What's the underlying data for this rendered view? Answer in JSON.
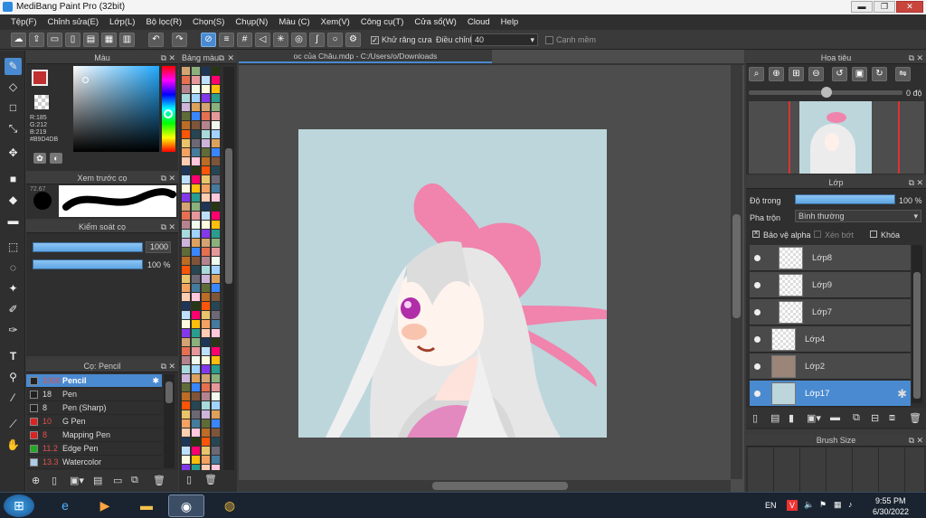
{
  "window": {
    "title": "MediBang Paint Pro (32bit)",
    "minimize": "▬",
    "restore": "❐",
    "close": "✕"
  },
  "menu": [
    "Tệp(F)",
    "Chỉnh sửa(E)",
    "Lớp(L)",
    "Bộ lọc(R)",
    "Chọn(S)",
    "Chụp(N)",
    "Màu (C)",
    "Xem(V)",
    "Công cụ(T)",
    "Cửa sổ(W)",
    "Cloud",
    "Help"
  ],
  "toolbar": {
    "antialias_label": "Khử răng cưa",
    "adjust_label": "Điều chỉnh",
    "adjust_value": "40",
    "edge_label": "Cạnh mềm"
  },
  "color_panel": {
    "title": "Màu",
    "r": "R:185",
    "g": "G:212",
    "b": "B:219",
    "hex": "#B9D4DB",
    "main_color": "#e8e8e8",
    "hue_marker_color": "#33ccff"
  },
  "preview_panel": {
    "title": "Xem trước cọ",
    "size": "72.67"
  },
  "brush_control": {
    "title": "Kiểm soát cọ",
    "size_value": "1000",
    "opacity_value": "100 %"
  },
  "swatch_panel": {
    "title": "Bảng màu"
  },
  "brush_panel": {
    "title": "Cọ: Pencil",
    "items": [
      {
        "size": "1000",
        "name": "Pencil",
        "color": "#222222",
        "selected": true
      },
      {
        "size": "18",
        "name": "Pen",
        "color": "#222222"
      },
      {
        "size": "8",
        "name": "Pen (Sharp)",
        "color": "#222222"
      },
      {
        "size": "10",
        "name": "G Pen",
        "color": "#dd2222"
      },
      {
        "size": "8",
        "name": "Mapping Pen",
        "color": "#dd2222"
      },
      {
        "size": "11.2",
        "name": "Edge Pen",
        "color": "#22aa22"
      },
      {
        "size": "13.3",
        "name": "Watercolor",
        "color": "#aacce8"
      }
    ]
  },
  "canvas": {
    "tab_label": "oc của Châu.mdp - C:/Users/o/Downloads",
    "bg": "#bcd6dc"
  },
  "navigator": {
    "title": "Hoa tiêu",
    "angle": "0 độ"
  },
  "layers": {
    "title": "Lớp",
    "opacity_label": "Độ trong",
    "opacity_value": "100 %",
    "blend_label": "Pha trộn",
    "blend_value": "Bình thường",
    "protect_alpha": "Bảo vệ alpha",
    "clipping": "Xén bớt",
    "lock": "Khóa",
    "items": [
      {
        "name": "Lớp8",
        "indent": true
      },
      {
        "name": "Lớp9",
        "indent": true
      },
      {
        "name": "Lớp7",
        "indent": true
      },
      {
        "name": "Lớp4",
        "indent": false
      },
      {
        "name": "Lớp2",
        "indent": false
      },
      {
        "name": "Lớp17",
        "indent": false,
        "selected": true
      }
    ]
  },
  "brush_size_panel": {
    "title": "Brush Size"
  },
  "taskbar": {
    "lang": "EN",
    "time": "9:55 PM",
    "date": "6/30/2022"
  }
}
